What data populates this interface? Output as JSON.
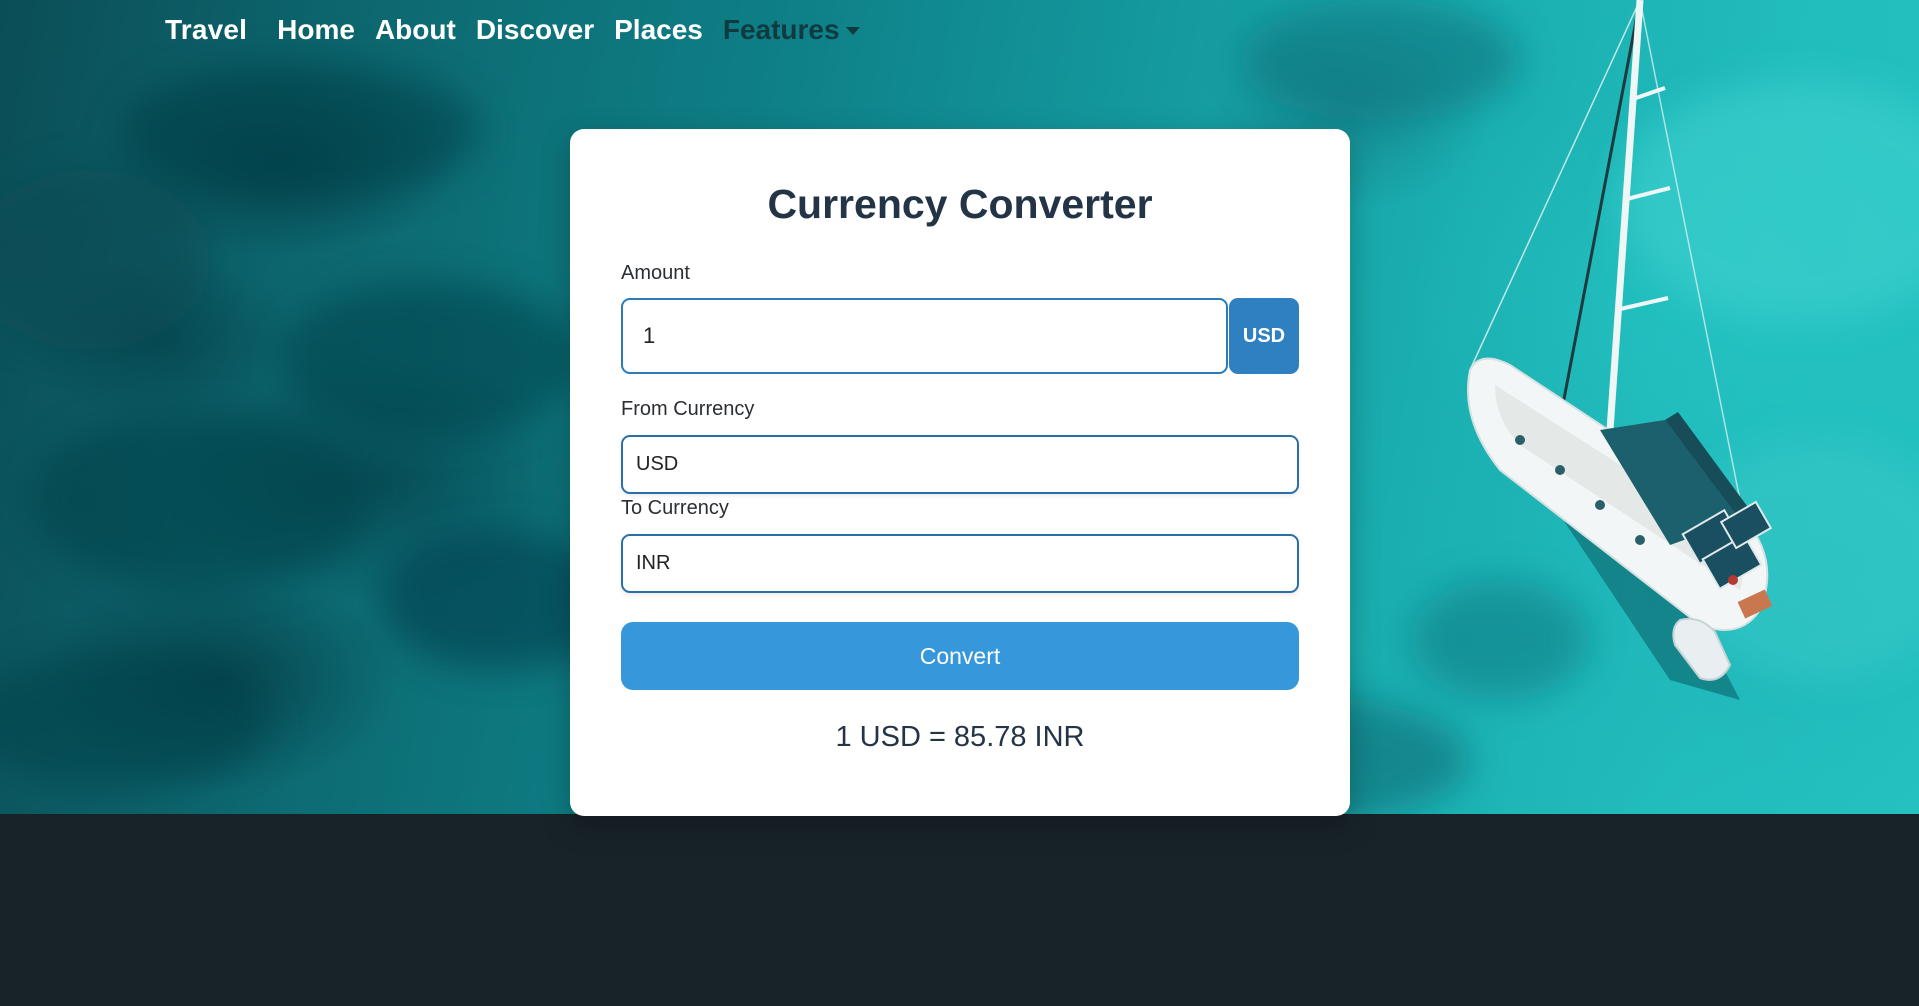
{
  "nav": {
    "brand": "Travel",
    "links": [
      "Home",
      "About",
      "Discover",
      "Places"
    ],
    "dropdown_label": "Features"
  },
  "converter": {
    "title": "Currency Converter",
    "amount_label": "Amount",
    "amount_value": "1",
    "amount_currency_badge": "USD",
    "from_label": "From Currency",
    "from_value": "USD",
    "to_label": "To Currency",
    "to_value": "INR",
    "convert_button": "Convert",
    "result_text": "1 USD = 85.78 INR"
  },
  "colors": {
    "primary_button": "#3797db",
    "badge": "#2f80c0",
    "input_border": "#2b7bb9",
    "footer_bg": "#182328",
    "heading_text": "#243447"
  },
  "icons": {
    "dropdown_caret": "caret-down-icon"
  }
}
